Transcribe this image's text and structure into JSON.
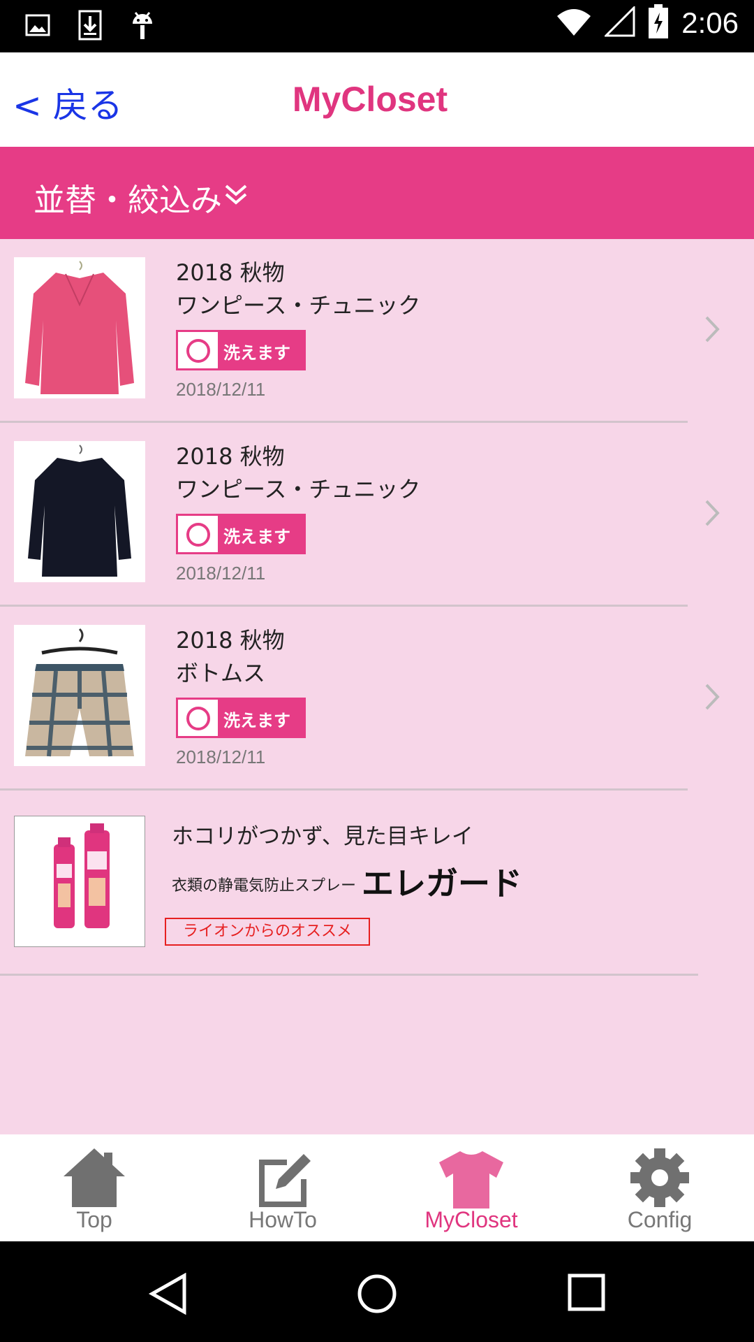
{
  "status_bar": {
    "time": "2:06",
    "left_icons": [
      "image-icon",
      "download-icon",
      "android-icon"
    ],
    "right_icons": [
      "wifi-icon",
      "signal-icon",
      "battery-icon"
    ]
  },
  "header": {
    "back_label": "< 戻る",
    "title": "MyCloset"
  },
  "filter": {
    "label": "並替・絞込み"
  },
  "items": [
    {
      "season": "2018 秋物",
      "category": "ワンピース・チュニック",
      "wash_label": "洗えます",
      "date": "2018/12/11",
      "image": "pink-tunic"
    },
    {
      "season": "2018 秋物",
      "category": "ワンピース・チュニック",
      "wash_label": "洗えます",
      "date": "2018/12/11",
      "image": "navy-dress"
    },
    {
      "season": "2018 秋物",
      "category": "ボトムス",
      "wash_label": "洗えます",
      "date": "2018/12/11",
      "image": "plaid-shorts"
    }
  ],
  "ad": {
    "catch": "ホコリがつかず、見た目キレイ",
    "sub": "衣類の静電気防止スプレー",
    "product": "エレガード",
    "recommend": "ライオンからのオススメ"
  },
  "tabs": [
    {
      "label": "Top",
      "icon": "home-icon"
    },
    {
      "label": "HowTo",
      "icon": "edit-icon"
    },
    {
      "label": "MyCloset",
      "icon": "tshirt-icon",
      "active": true
    },
    {
      "label": "Config",
      "icon": "gear-icon"
    }
  ],
  "colors": {
    "accent": "#e63c86",
    "title": "#e0357f",
    "background": "#f7d6e8",
    "back_link": "#1a35e6"
  }
}
